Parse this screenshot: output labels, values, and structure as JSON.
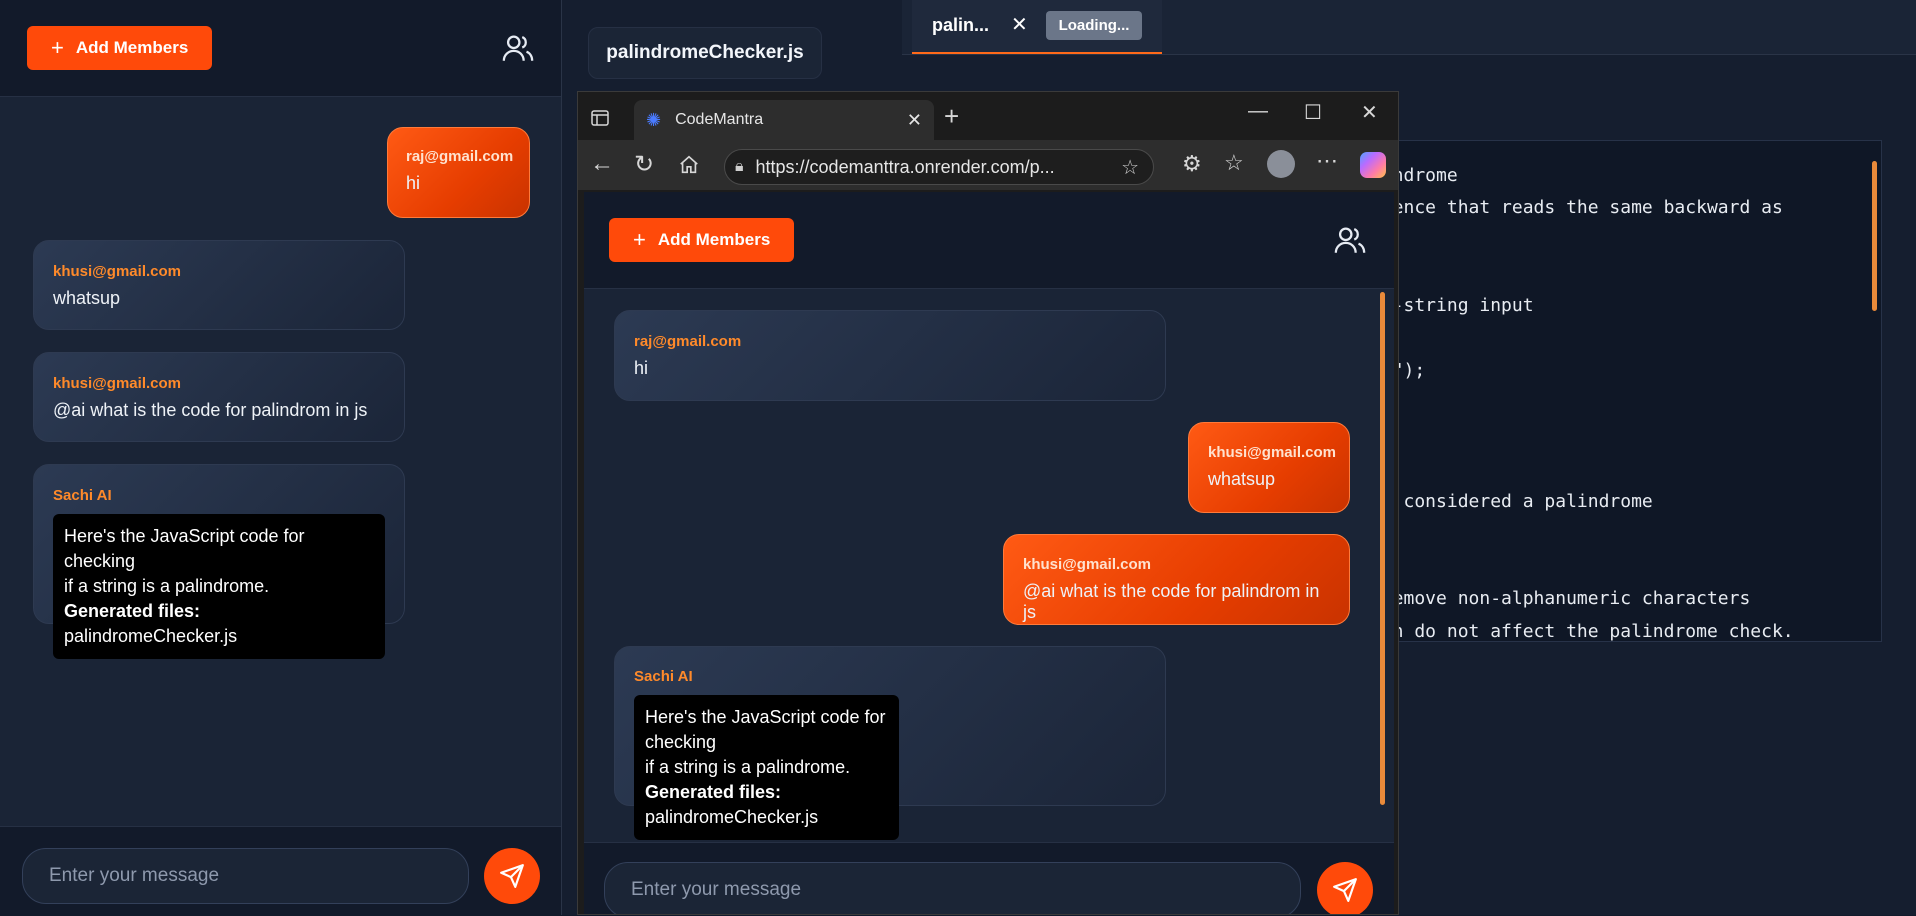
{
  "left_panel": {
    "add_members_label": "Add Members",
    "messages": [
      {
        "email": "raj@gmail.com",
        "text": "hi"
      },
      {
        "email": "khusi@gmail.com",
        "text": "whatsup"
      },
      {
        "email": "khusi@gmail.com",
        "text": "@ai what is the code for palindrom in js"
      },
      {
        "email": "Sachi AI",
        "ai_line1": "Here's the JavaScript code for checking",
        "ai_line2": "if a string is a palindrome.",
        "generated_label": "Generated files:",
        "generated_file": "palindromeChecker.js"
      }
    ],
    "input_placeholder": "Enter your message"
  },
  "editor": {
    "file_tab_label": "palindromeChecker.js",
    "open_tab_label": "palin...",
    "loading_label": "Loading...",
    "code_lines": [
      "lindrome",
      "quence that reads the same backward as",
      "on-string input",
      "g.\");",
      "be considered a palindrome",
      " remove non-alphanumeric characters",
      "ion do not affect the palindrome check."
    ]
  },
  "browser": {
    "tab_title": "CodeMantra",
    "url": "https://codemanttra.onrender.com/p...",
    "app": {
      "add_members_label": "Add Members",
      "messages": [
        {
          "email": "raj@gmail.com",
          "text": "hi"
        },
        {
          "email": "khusi@gmail.com",
          "text": "whatsup"
        },
        {
          "email": "khusi@gmail.com",
          "text": "@ai what is the code for palindrom in js"
        },
        {
          "email": "Sachi AI",
          "ai_line1": "Here's the JavaScript code for checking",
          "ai_line2": "if a string is a palindrome.",
          "generated_label": "Generated files:",
          "generated_file": "palindromeChecker.js"
        }
      ],
      "input_placeholder": "Enter your message"
    }
  },
  "colors": {
    "accent": "#ff4a0a",
    "panel_bg": "#1a2436",
    "header_bg": "#121a2a"
  }
}
